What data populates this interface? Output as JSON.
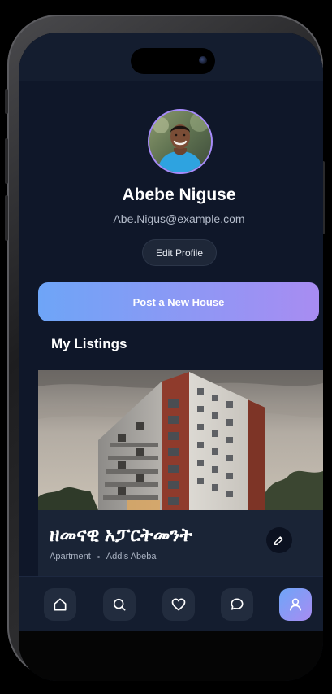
{
  "profile": {
    "name": "Abebe Niguse",
    "email": "Abe.Nigus@example.com",
    "edit_label": "Edit Profile"
  },
  "actions": {
    "post_label": "Post a New House"
  },
  "listings": {
    "title": "My Listings",
    "items": [
      {
        "title": "ዘመናዊ አፓርትመንት",
        "type": "Apartment",
        "location": "Addis Abeba"
      }
    ]
  },
  "nav": {
    "items": [
      {
        "icon": "home-icon",
        "active": false
      },
      {
        "icon": "search-icon",
        "active": false
      },
      {
        "icon": "heart-icon",
        "active": false
      },
      {
        "icon": "chat-icon",
        "active": false
      },
      {
        "icon": "user-icon",
        "active": true
      }
    ]
  },
  "colors": {
    "background": "#0f1729",
    "accent_start": "#6ea5f7",
    "accent_end": "#a88cf2",
    "card": "#1a2436"
  }
}
